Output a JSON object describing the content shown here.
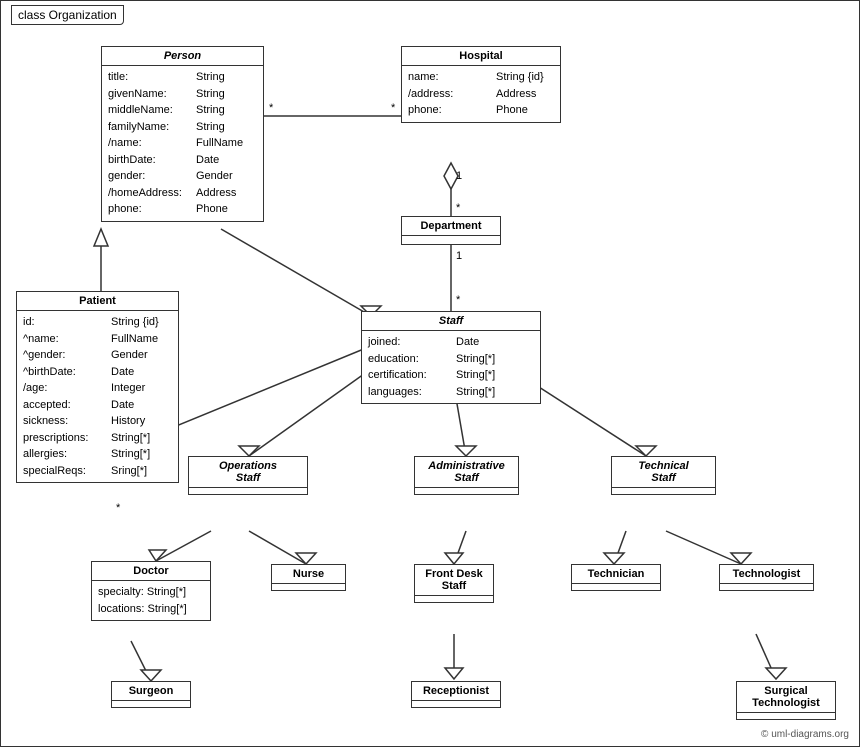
{
  "title": "class Organization",
  "classes": {
    "person": {
      "name": "Person",
      "italic": true,
      "attrs": [
        {
          "name": "title:",
          "type": "String"
        },
        {
          "name": "givenName:",
          "type": "String"
        },
        {
          "name": "middleName:",
          "type": "String"
        },
        {
          "name": "familyName:",
          "type": "String"
        },
        {
          "name": "/name:",
          "type": "FullName"
        },
        {
          "name": "birthDate:",
          "type": "Date"
        },
        {
          "name": "gender:",
          "type": "Gender"
        },
        {
          "name": "/homeAddress:",
          "type": "Address"
        },
        {
          "name": "phone:",
          "type": "Phone"
        }
      ]
    },
    "hospital": {
      "name": "Hospital",
      "italic": false,
      "attrs": [
        {
          "name": "name:",
          "type": "String {id}"
        },
        {
          "name": "/address:",
          "type": "Address"
        },
        {
          "name": "phone:",
          "type": "Phone"
        }
      ]
    },
    "patient": {
      "name": "Patient",
      "italic": false,
      "attrs": [
        {
          "name": "id:",
          "type": "String {id}"
        },
        {
          "name": "^name:",
          "type": "FullName"
        },
        {
          "name": "^gender:",
          "type": "Gender"
        },
        {
          "name": "^birthDate:",
          "type": "Date"
        },
        {
          "name": "/age:",
          "type": "Integer"
        },
        {
          "name": "accepted:",
          "type": "Date"
        },
        {
          "name": "sickness:",
          "type": "History"
        },
        {
          "name": "prescriptions:",
          "type": "String[*]"
        },
        {
          "name": "allergies:",
          "type": "String[*]"
        },
        {
          "name": "specialReqs:",
          "type": "Sring[*]"
        }
      ]
    },
    "department": {
      "name": "Department",
      "italic": false,
      "attrs": []
    },
    "staff": {
      "name": "Staff",
      "italic": true,
      "attrs": [
        {
          "name": "joined:",
          "type": "Date"
        },
        {
          "name": "education:",
          "type": "String[*]"
        },
        {
          "name": "certification:",
          "type": "String[*]"
        },
        {
          "name": "languages:",
          "type": "String[*]"
        }
      ]
    },
    "operations_staff": {
      "name": "Operations\nStaff",
      "italic": true,
      "attrs": []
    },
    "administrative_staff": {
      "name": "Administrative\nStaff",
      "italic": true,
      "attrs": []
    },
    "technical_staff": {
      "name": "Technical\nStaff",
      "italic": true,
      "attrs": []
    },
    "doctor": {
      "name": "Doctor",
      "italic": false,
      "attrs": [
        {
          "name": "specialty:",
          "type": "String[*]"
        },
        {
          "name": "locations:",
          "type": "String[*]"
        }
      ]
    },
    "nurse": {
      "name": "Nurse",
      "italic": false,
      "attrs": []
    },
    "front_desk_staff": {
      "name": "Front Desk\nStaff",
      "italic": false,
      "attrs": []
    },
    "technician": {
      "name": "Technician",
      "italic": false,
      "attrs": []
    },
    "technologist": {
      "name": "Technologist",
      "italic": false,
      "attrs": []
    },
    "surgeon": {
      "name": "Surgeon",
      "italic": false,
      "attrs": []
    },
    "receptionist": {
      "name": "Receptionist",
      "italic": false,
      "attrs": []
    },
    "surgical_technologist": {
      "name": "Surgical\nTechnologist",
      "italic": false,
      "attrs": []
    }
  },
  "copyright": "© uml-diagrams.org"
}
